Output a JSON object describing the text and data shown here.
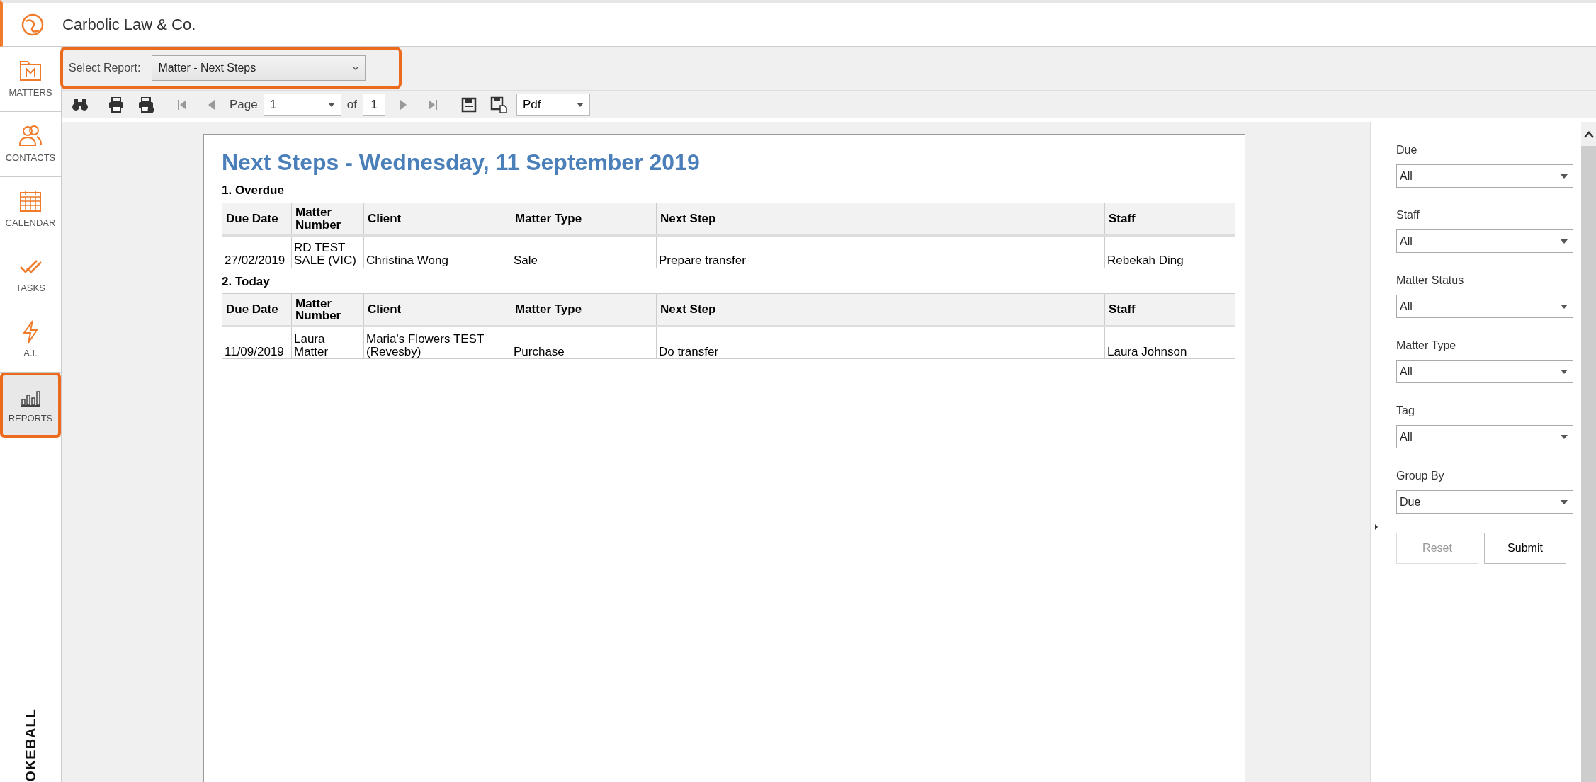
{
  "app": {
    "title": "Carbolic Law & Co."
  },
  "sidebar": {
    "items": [
      {
        "label": "MATTERS",
        "selected": false
      },
      {
        "label": "CONTACTS",
        "selected": false
      },
      {
        "label": "CALENDAR",
        "selected": false
      },
      {
        "label": "TASKS",
        "selected": false
      },
      {
        "label": "A.I.",
        "selected": false
      },
      {
        "label": "REPORTS",
        "selected": true
      }
    ],
    "brand": "OKEBALL"
  },
  "report_selector": {
    "label": "Select Report:",
    "value": "Matter - Next Steps"
  },
  "toolbar": {
    "page_label": "Page",
    "page": "1",
    "of_label": "of",
    "total": "1",
    "format": "Pdf"
  },
  "report": {
    "title": "Next Steps - Wednesday, 11 September 2019",
    "groups": [
      {
        "heading": "1. Overdue",
        "columns": [
          "Due Date",
          "Matter Number",
          "Client",
          "Matter Type",
          "Next Step",
          "Staff"
        ],
        "rows": [
          [
            "27/02/2019",
            "RD TEST SALE (VIC)",
            "Christina Wong",
            "Sale",
            "Prepare transfer",
            "Rebekah Ding"
          ]
        ]
      },
      {
        "heading": "2. Today",
        "columns": [
          "Due Date",
          "Matter Number",
          "Client",
          "Matter Type",
          "Next Step",
          "Staff"
        ],
        "rows": [
          [
            "11/09/2019",
            "Laura Matter",
            "Maria's Flowers TEST (Revesby)",
            "Purchase",
            "Do transfer",
            "Laura Johnson"
          ]
        ]
      }
    ]
  },
  "filters": [
    {
      "label": "Due",
      "value": "All"
    },
    {
      "label": "Staff",
      "value": "All"
    },
    {
      "label": "Matter Status",
      "value": "All"
    },
    {
      "label": "Matter Type",
      "value": "All"
    },
    {
      "label": "Tag",
      "value": "All"
    },
    {
      "label": "Group By",
      "value": "Due"
    }
  ],
  "buttons": [
    {
      "label": "Reset",
      "disabled": true
    },
    {
      "label": "Submit",
      "disabled": false
    }
  ]
}
